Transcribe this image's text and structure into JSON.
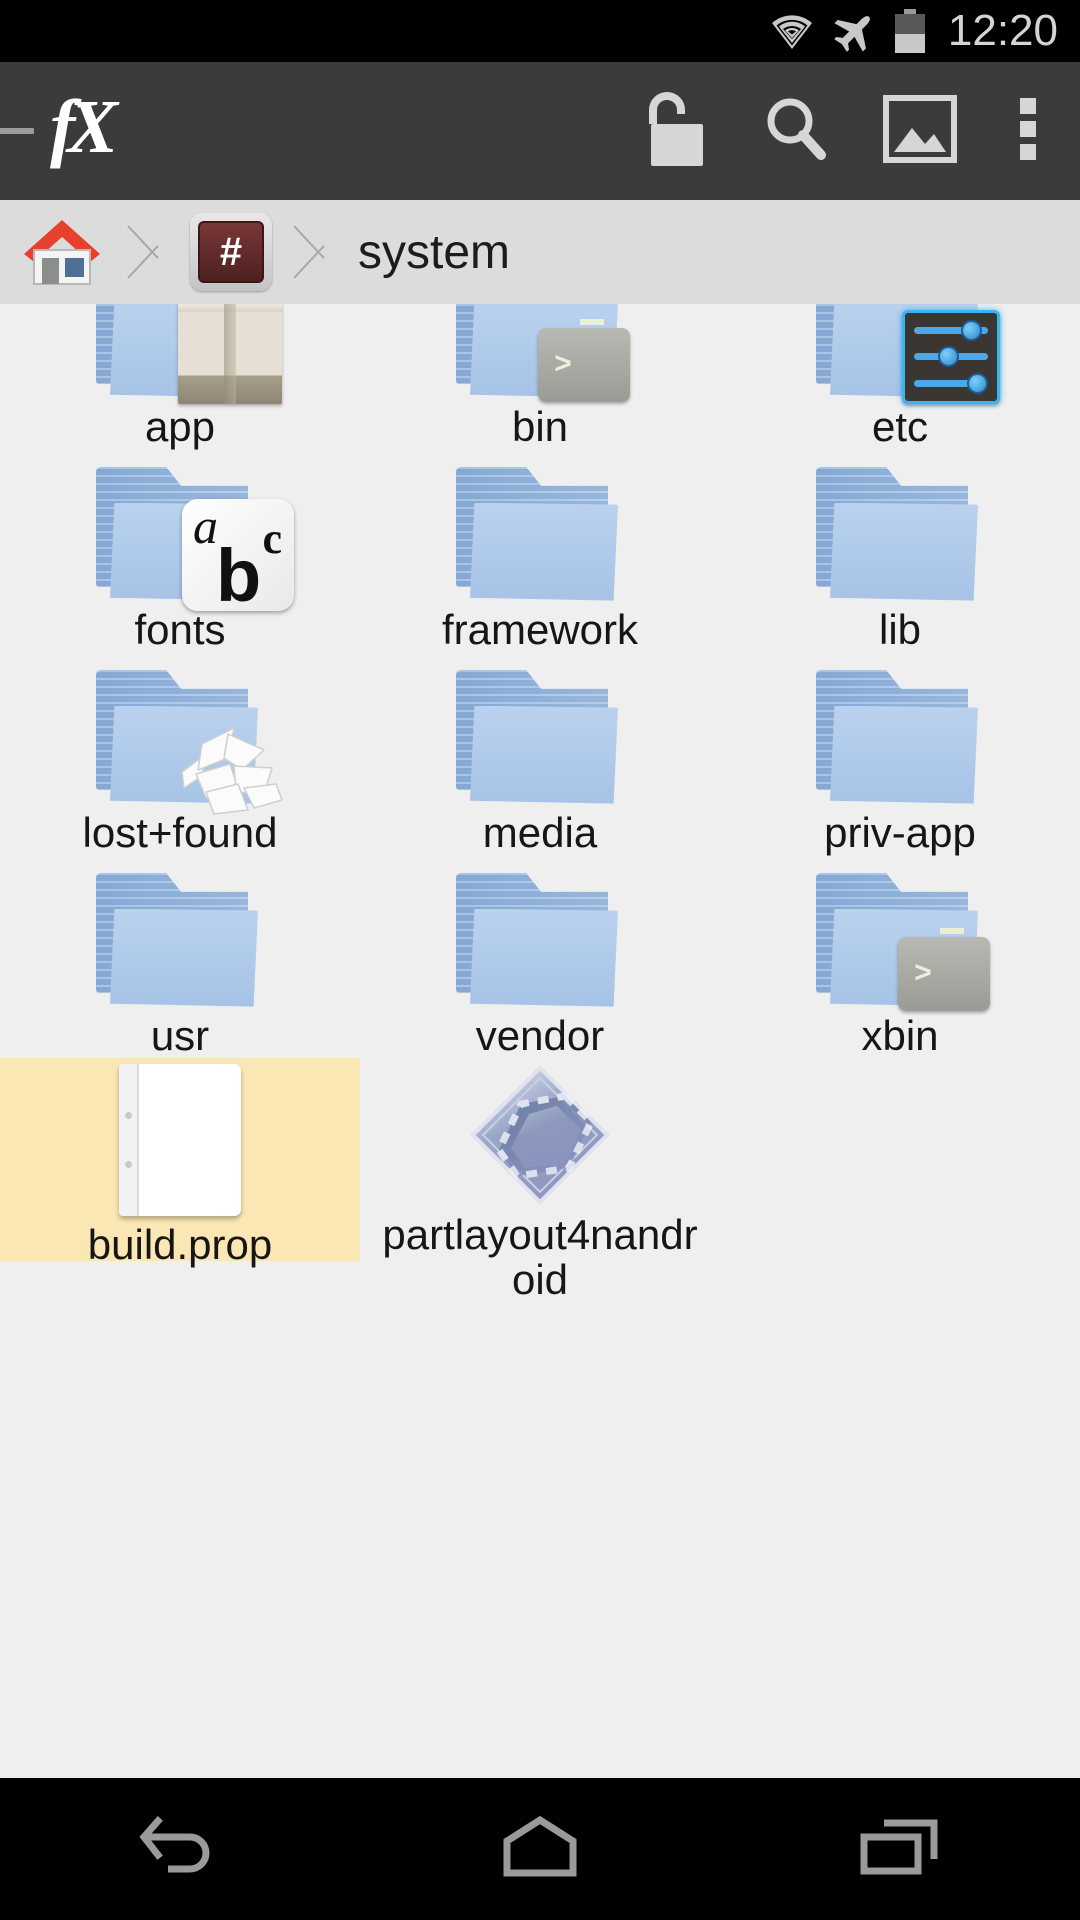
{
  "statusbar": {
    "time": "12:20",
    "icons": [
      "wifi-icon",
      "airplane-mode-icon",
      "battery-icon"
    ],
    "battery_level_percent": 45
  },
  "toolbar": {
    "app_logo": "fX",
    "up_label": "—",
    "actions": [
      {
        "name": "unlock-root-button",
        "label": "Unlock"
      },
      {
        "name": "search-button",
        "label": "Search"
      },
      {
        "name": "gallery-button",
        "label": "Gallery"
      },
      {
        "name": "overflow-menu-button",
        "label": "More options"
      }
    ]
  },
  "breadcrumb": {
    "home_label": "Home",
    "root_label": "#",
    "current_label": "system"
  },
  "files": {
    "items": [
      {
        "name": "app",
        "type": "folder",
        "icon": "folder-package-icon",
        "selected": false
      },
      {
        "name": "bin",
        "type": "folder",
        "icon": "folder-terminal-icon",
        "selected": false
      },
      {
        "name": "etc",
        "type": "folder",
        "icon": "folder-settings-icon",
        "selected": false
      },
      {
        "name": "fonts",
        "type": "folder",
        "icon": "folder-fonts-icon",
        "selected": false
      },
      {
        "name": "framework",
        "type": "folder",
        "icon": "folder-icon",
        "selected": false
      },
      {
        "name": "lib",
        "type": "folder",
        "icon": "folder-icon",
        "selected": false
      },
      {
        "name": "lost+found",
        "type": "folder",
        "icon": "folder-crumple-icon",
        "selected": false
      },
      {
        "name": "media",
        "type": "folder",
        "icon": "folder-icon",
        "selected": false
      },
      {
        "name": "priv-app",
        "type": "folder",
        "icon": "folder-icon",
        "selected": false
      },
      {
        "name": "usr",
        "type": "folder",
        "icon": "folder-icon",
        "selected": false
      },
      {
        "name": "vendor",
        "type": "folder",
        "icon": "folder-icon",
        "selected": false
      },
      {
        "name": "xbin",
        "type": "folder",
        "icon": "folder-terminal-icon",
        "selected": false
      },
      {
        "name": "build.prop",
        "type": "file",
        "icon": "document-icon",
        "selected": true
      },
      {
        "name": "partlayout4nandroid",
        "type": "file",
        "icon": "binary-file-icon",
        "selected": false
      }
    ]
  },
  "navbar": {
    "buttons": [
      {
        "name": "back-button",
        "label": "Back"
      },
      {
        "name": "home-button",
        "label": "Home"
      },
      {
        "name": "recents-button",
        "label": "Recents"
      }
    ]
  },
  "colors": {
    "status_bar_bg": "#000000",
    "toolbar_bg": "#3b3b3b",
    "breadcrumb_bg": "#dcdcdc",
    "content_bg": "#efefef",
    "selection_bg": "#fae7b3",
    "folder_blue": "#a6c3e6",
    "root_chip_red": "#4e2121",
    "home_roof_red": "#e8402f"
  }
}
